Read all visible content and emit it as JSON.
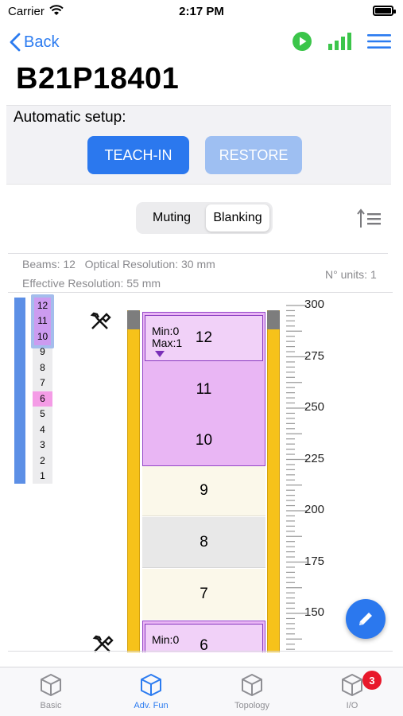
{
  "status_bar": {
    "carrier": "Carrier",
    "time": "2:17 PM"
  },
  "nav": {
    "back_label": "Back",
    "title": "B21P18401"
  },
  "setup": {
    "label": "Automatic setup:",
    "teach_in": "TEACH-IN",
    "restore": "RESTORE"
  },
  "segment": {
    "muting": "Muting",
    "blanking": "Blanking",
    "selected": "Blanking"
  },
  "info": {
    "beams": "Beams: 12",
    "optical_resolution": "Optical Resolution: 30 mm",
    "effective_resolution": "Effective Resolution: 55 mm",
    "units": "N° units: 1"
  },
  "beam_list": [
    "12",
    "11",
    "10",
    "9",
    "8",
    "7",
    "6",
    "5",
    "4",
    "3",
    "2",
    "1"
  ],
  "tower": {
    "zone_top": {
      "min": "Min:0",
      "max": "Max:1",
      "beams": [
        "12",
        "11",
        "10"
      ]
    },
    "cells": [
      "9",
      "8",
      "7"
    ],
    "zone_bottom": {
      "min": "Min:0",
      "beam": "6"
    }
  },
  "ruler_labels": [
    "300",
    "275",
    "250",
    "225",
    "200",
    "175",
    "150"
  ],
  "tabs": [
    {
      "label": "Basic",
      "icon": "cube-icon"
    },
    {
      "label": "Adv. Fun",
      "icon": "cube-icon"
    },
    {
      "label": "Topology",
      "icon": "cube-icon"
    },
    {
      "label": "I/O",
      "icon": "cube-icon",
      "badge": "3"
    }
  ],
  "colors": {
    "accent": "#2b7bf0",
    "green": "#3bc54a",
    "blanking": "#e9b6f4",
    "rail": "#f6c21a"
  }
}
